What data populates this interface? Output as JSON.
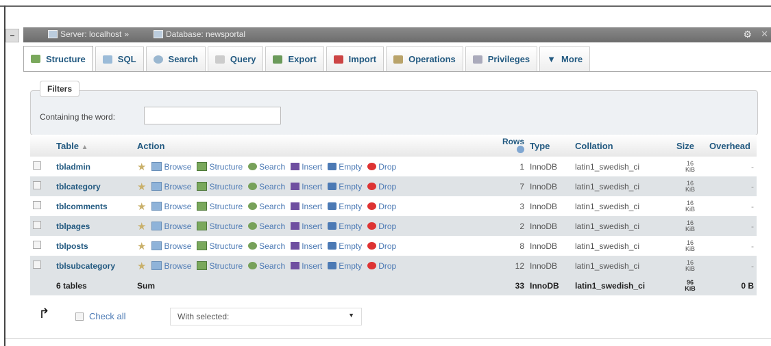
{
  "breadcrumb": {
    "server": "Server: localhost",
    "database": "Database: newsportal"
  },
  "tabs": [
    "Structure",
    "SQL",
    "Search",
    "Query",
    "Export",
    "Import",
    "Operations",
    "Privileges",
    "More"
  ],
  "filters": {
    "legend": "Filters",
    "label": "Containing the word:",
    "value": ""
  },
  "table_headers": {
    "table": "Table",
    "action": "Action",
    "rows": "Rows",
    "type": "Type",
    "collation": "Collation",
    "size": "Size",
    "overhead": "Overhead"
  },
  "actions": {
    "browse": "Browse",
    "structure": "Structure",
    "search": "Search",
    "insert": "Insert",
    "empty": "Empty",
    "drop": "Drop"
  },
  "rows": [
    {
      "name": "tbladmin",
      "rows": "1",
      "type": "InnoDB",
      "collation": "latin1_swedish_ci",
      "size_num": "16",
      "size_unit": "KiB",
      "overhead": "-"
    },
    {
      "name": "tblcategory",
      "rows": "7",
      "type": "InnoDB",
      "collation": "latin1_swedish_ci",
      "size_num": "16",
      "size_unit": "KiB",
      "overhead": "-"
    },
    {
      "name": "tblcomments",
      "rows": "3",
      "type": "InnoDB",
      "collation": "latin1_swedish_ci",
      "size_num": "16",
      "size_unit": "KiB",
      "overhead": "-"
    },
    {
      "name": "tblpages",
      "rows": "2",
      "type": "InnoDB",
      "collation": "latin1_swedish_ci",
      "size_num": "16",
      "size_unit": "KiB",
      "overhead": "-"
    },
    {
      "name": "tblposts",
      "rows": "8",
      "type": "InnoDB",
      "collation": "latin1_swedish_ci",
      "size_num": "16",
      "size_unit": "KiB",
      "overhead": "-"
    },
    {
      "name": "tblsubcategory",
      "rows": "12",
      "type": "InnoDB",
      "collation": "latin1_swedish_ci",
      "size_num": "16",
      "size_unit": "KiB",
      "overhead": "-"
    }
  ],
  "footer": {
    "tables": "6 tables",
    "sum": "Sum",
    "rows": "33",
    "type": "InnoDB",
    "collation": "latin1_swedish_ci",
    "size_num": "96",
    "size_unit": "KiB",
    "overhead": "0 B"
  },
  "bottom": {
    "check_all": "Check all",
    "with_selected": "With selected:"
  }
}
